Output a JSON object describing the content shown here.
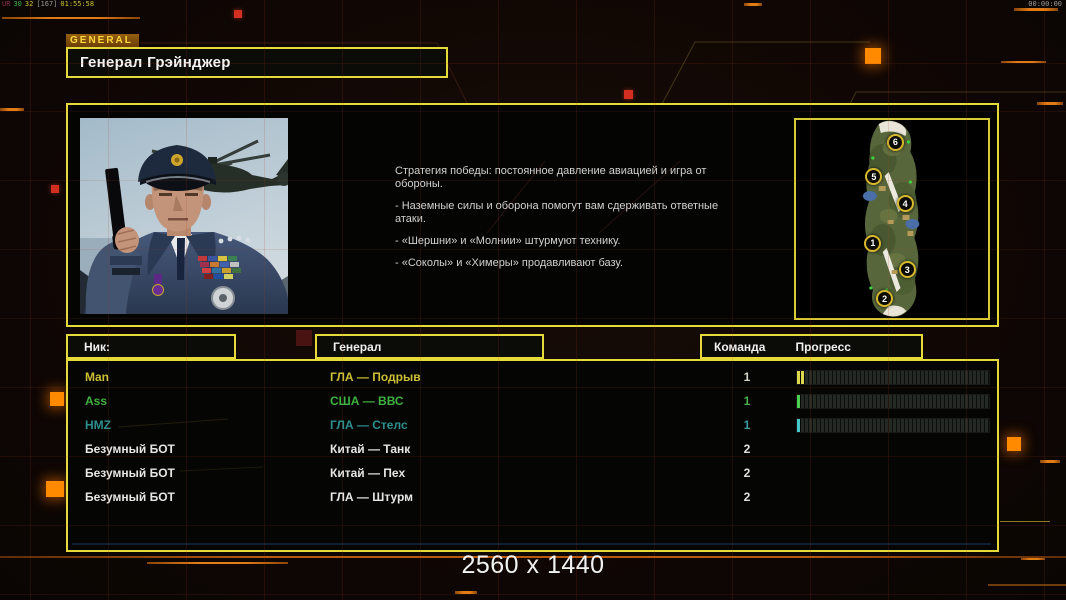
{
  "overlay": {
    "debug": {
      "tag": "UR",
      "fps": "30",
      "val": "32",
      "bracket": "[167]",
      "clock": "01:55:58"
    },
    "timer": "00:00:00"
  },
  "header": {
    "tab": "GENERAL",
    "title": "Генерал Грэйнджер"
  },
  "briefing": {
    "paragraphs": [
      "Стратегия победы: постоянное давление авиацией и игра от\n обороны.",
      "- Наземные силы и оборона помогут вам сдерживать ответные\n атаки.",
      "- «Шершни» и «Молнии» штурмуют технику.",
      "- «Соколы» и «Химеры» продавливают базу."
    ]
  },
  "map": {
    "markers": [
      {
        "n": "6",
        "x": 51.5,
        "y": 11
      },
      {
        "n": "5",
        "x": 40.3,
        "y": 28.5
      },
      {
        "n": "4",
        "x": 56.6,
        "y": 42
      },
      {
        "n": "1",
        "x": 39.8,
        "y": 62
      },
      {
        "n": "3",
        "x": 57.7,
        "y": 75.5
      },
      {
        "n": "2",
        "x": 45.9,
        "y": 90
      }
    ]
  },
  "table": {
    "headers": {
      "nick": "Ник:",
      "general": "Генерал",
      "team": "Команда",
      "progress": "Прогресс"
    },
    "rows": [
      {
        "nick": "Man",
        "general": "ГЛА — Подрыв",
        "team": "1",
        "color": "#cdbf35",
        "team_color": "#d6d6ca",
        "bar_color": "#ddd84e",
        "progress": 4
      },
      {
        "nick": "Ass",
        "general": "США — ВВС",
        "team": "1",
        "color": "#3fb23f",
        "team_color": "#4ab04a",
        "bar_color": "#4cd050",
        "progress": 2
      },
      {
        "nick": "HMZ",
        "general": "ГЛА — Стелс",
        "team": "1",
        "color": "#2e8f8f",
        "team_color": "#3a9a9a",
        "bar_color": "#46c8c8",
        "progress": 2
      },
      {
        "nick": "Безумный БОТ",
        "general": "Китай — Танк",
        "team": "2",
        "color": "#e6e6e6",
        "team_color": "#e0e0e0",
        "bar_color": null,
        "progress": null
      },
      {
        "nick": "Безумный БОТ",
        "general": "Китай — Пех",
        "team": "2",
        "color": "#e6e6e6",
        "team_color": "#e0e0e0",
        "bar_color": null,
        "progress": null
      },
      {
        "nick": "Безумный БОТ",
        "general": "ГЛА — Штурм",
        "team": "2",
        "color": "#e6e6e6",
        "team_color": "#e0e0e0",
        "bar_color": null,
        "progress": null
      }
    ]
  },
  "footer": {
    "resolution": "2560 x 1440"
  },
  "colors": {
    "panel_border": "#e6d93a",
    "accent_orange": "#ff8a00",
    "background": "#100704"
  }
}
